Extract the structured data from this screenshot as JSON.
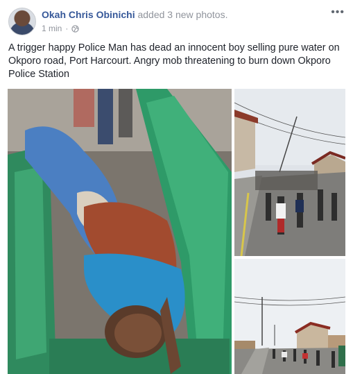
{
  "post": {
    "author": "Okah Chris Obinichi",
    "action": "added 3 new photos.",
    "timestamp": "1 min",
    "separator": "·",
    "privacy_icon": "globe-icon",
    "more_icon": "more-options-icon",
    "more_label": "•••",
    "text": "A trigger happy Police Man has dead an innocent boy selling pure water on Okporo road, Port Harcourt. Angry mob threatening to burn down Okporo Police Station"
  },
  "colors": {
    "author_link": "#365899",
    "secondary_text": "#90949c",
    "body_text": "#1d2129"
  }
}
